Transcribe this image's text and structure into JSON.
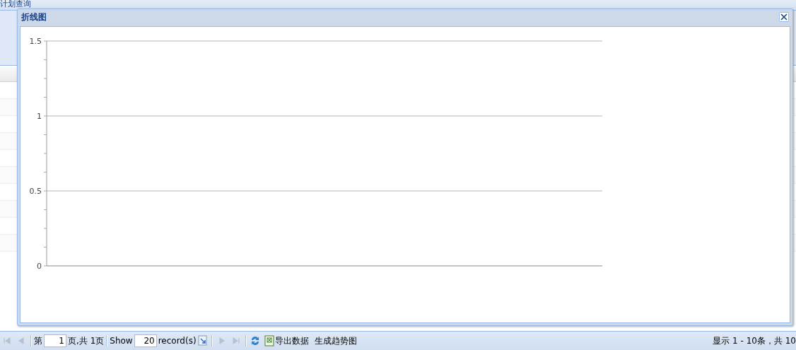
{
  "background_panel": {
    "title": "计划查询"
  },
  "dialog": {
    "title": "折线图",
    "chart": {
      "y_tick_labels": [
        "1.5",
        "1",
        "0.5",
        "0"
      ]
    }
  },
  "pager": {
    "nav": [
      {
        "kind": "first",
        "disabled": true
      },
      {
        "kind": "prev",
        "disabled": true
      },
      {
        "kind": "next",
        "disabled": true
      },
      {
        "kind": "last",
        "disabled": true
      }
    ],
    "page_prefix": "第",
    "page_value": "1",
    "page_suffix": "页,共 1页",
    "show_label": "Show",
    "page_size": "20",
    "size_suffix": "record(s)",
    "buttons": [
      {
        "kind": "export",
        "label": "导出数据"
      },
      {
        "kind": "trend",
        "label": "生成趋势图"
      }
    ],
    "summary": "显示 1 - 10条，共 10"
  }
}
